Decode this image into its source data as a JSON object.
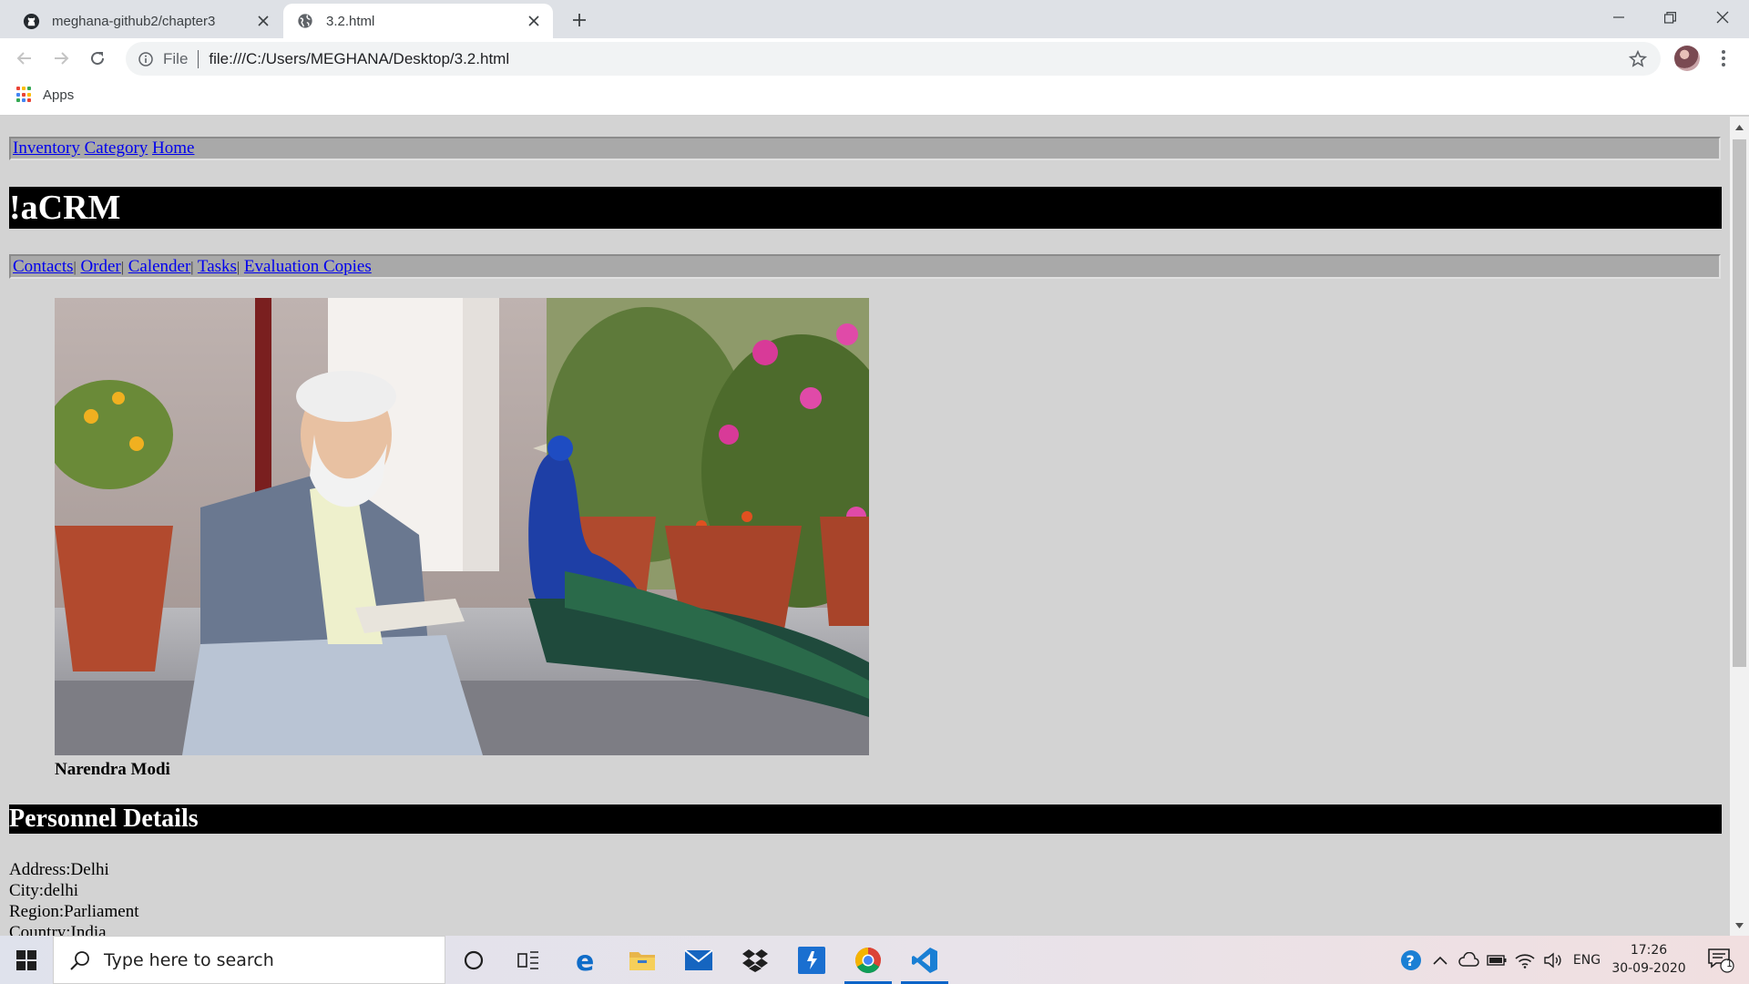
{
  "browser": {
    "tabs": [
      {
        "title": "meghana-github2/chapter3",
        "icon": "github-icon",
        "active": false
      },
      {
        "title": "3.2.html",
        "icon": "globe-icon",
        "active": true
      }
    ],
    "address": {
      "scheme": "File",
      "url": "file:///C:/Users/MEGHANA/Desktop/3.2.html"
    },
    "bookmarks": {
      "apps_label": "Apps"
    }
  },
  "page": {
    "top_nav": [
      "Inventory",
      "Category",
      "Home"
    ],
    "banner_title": "!aCRM",
    "sub_nav": [
      "Contacts",
      "Order",
      "Calender",
      "Tasks",
      "Evaluation Copies"
    ],
    "sub_nav_separator": "|",
    "photo_caption": "Narendra Modi",
    "section_title": "Personnel Details",
    "details": [
      "Address:Delhi",
      "City:delhi",
      "Region:Parliament",
      "Country:India"
    ]
  },
  "taskbar": {
    "search_placeholder": "Type here to search",
    "language": "ENG",
    "time": "17:26",
    "date": "30-09-2020",
    "notification_count": "1"
  },
  "colors": {
    "page_bg": "#d3d3d3",
    "nav_bg": "#a9a9a9",
    "banner_bg": "#000000",
    "link": "#0000ee"
  }
}
